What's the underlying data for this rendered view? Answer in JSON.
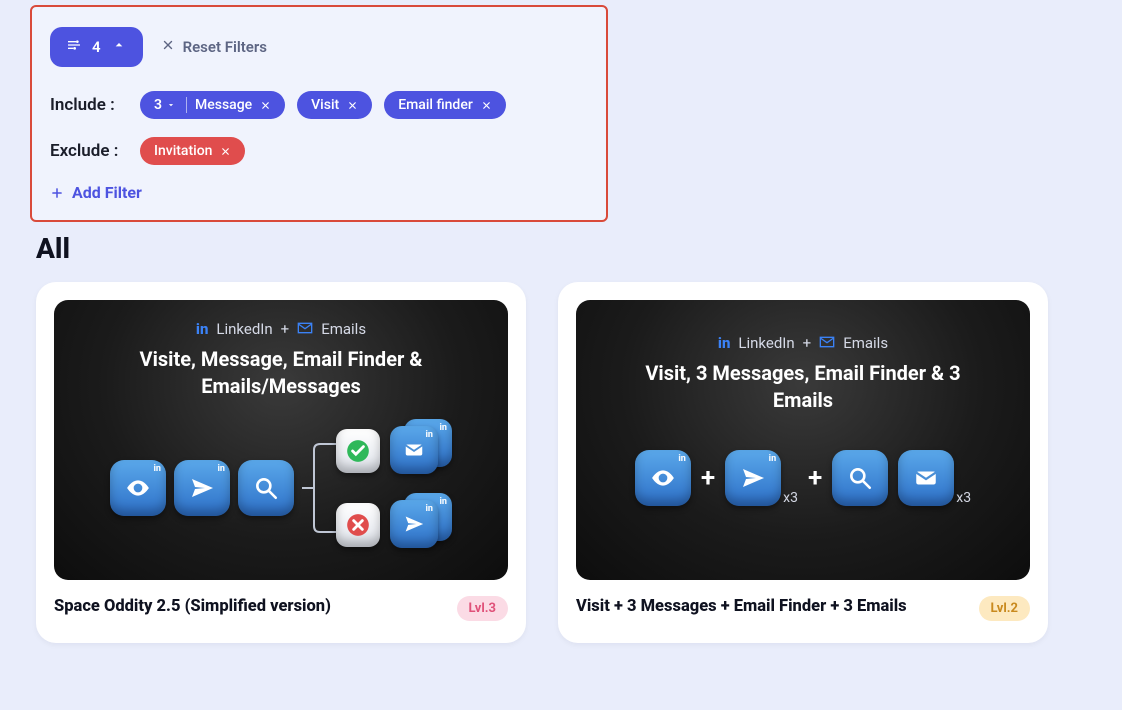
{
  "filters": {
    "count": "4",
    "reset_label": "Reset Filters",
    "include_label": "Include :",
    "exclude_label": "Exclude :",
    "include": [
      {
        "count": "3",
        "label": "Message"
      },
      {
        "label": "Visit"
      },
      {
        "label": "Email finder"
      }
    ],
    "exclude": [
      {
        "label": "Invitation"
      }
    ],
    "add_filter_label": "Add Filter"
  },
  "section_heading": "All",
  "channels": {
    "linkedin": "LinkedIn",
    "plus": "+",
    "emails": "Emails"
  },
  "cards": [
    {
      "visual_title": "Visite, Message, Email Finder & Emails/Messages",
      "name": "Space Oddity 2.5 (Simplified version)",
      "level": "Lvl.3",
      "level_style": "pink"
    },
    {
      "visual_title": "Visit, 3 Messages, Email Finder & 3 Emails",
      "name": "Visit + 3 Messages + Email Finder + 3 Emails",
      "level": "Lvl.2",
      "level_style": "yellow",
      "x3": "x3"
    }
  ]
}
